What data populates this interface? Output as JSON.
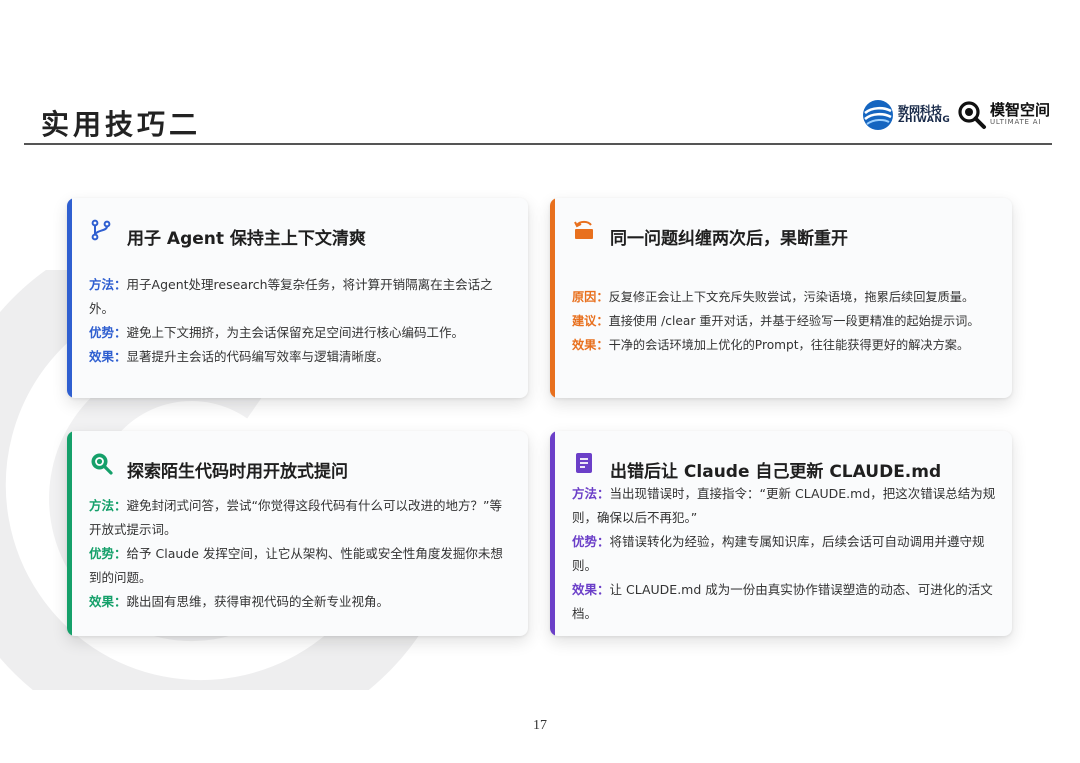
{
  "header": {
    "title": "实用技巧二",
    "logos": [
      {
        "name": "致网科技",
        "en": "ZHIWANG"
      },
      {
        "name": "模智空间",
        "en": "ULTIMATE AI"
      }
    ]
  },
  "cards": [
    {
      "icon": "git-branch-icon",
      "accent": "#2f5fd0",
      "title": "用子 Agent 保持主上下文清爽",
      "lines": [
        {
          "label": "方法：",
          "text": "用子Agent处理research等复杂任务，将计算开销隔离在主会话之外。"
        },
        {
          "label": "优势：",
          "text": "避免上下文拥挤，为主会话保留充足空间进行核心编码工作。"
        },
        {
          "label": "效果：",
          "text": "显著提升主会话的代码编写效率与逻辑清晰度。"
        }
      ]
    },
    {
      "icon": "restart-icon",
      "accent": "#e8701e",
      "title": "同一问题纠缠两次后，果断重开",
      "lines": [
        {
          "label": "原因：",
          "text": "反复修正会让上下文充斥失败尝试，污染语境，拖累后续回复质量。"
        },
        {
          "label": "建议：",
          "text": "直接使用 /clear 重开对话，并基于经验写一段更精准的起始提示词。"
        },
        {
          "label": "效果：",
          "text": "干净的会话环境加上优化的Prompt，往往能获得更好的解决方案。"
        }
      ]
    },
    {
      "icon": "search-icon",
      "accent": "#15a06a",
      "title": "探索陌生代码时用开放式提问",
      "lines": [
        {
          "label": "方法：",
          "text": "避免封闭式问答，尝试“你觉得这段代码有什么可以改进的地方？”等开放式提示词。"
        },
        {
          "label": "优势：",
          "text": "给予 Claude 发挥空间，让它从架构、性能或安全性角度发掘你未想到的问题。"
        },
        {
          "label": "效果：",
          "text": "跳出固有思维，获得审视代码的全新专业视角。"
        }
      ]
    },
    {
      "icon": "document-icon",
      "accent": "#6b3fc8",
      "title": "出错后让 Claude 自己更新 CLAUDE.md",
      "lines": [
        {
          "label": "方法：",
          "text": "当出现错误时，直接指令：“更新 CLAUDE.md，把这次错误总结为规则，确保以后不再犯。”"
        },
        {
          "label": "优势：",
          "text": "将错误转化为经验，构建专属知识库，后续会话可自动调用并遵守规则。"
        },
        {
          "label": "效果：",
          "text": "让 CLAUDE.md 成为一份由真实协作错误塑造的动态、可进化的活文档。"
        }
      ]
    }
  ],
  "footer": {
    "page_number": "17"
  }
}
